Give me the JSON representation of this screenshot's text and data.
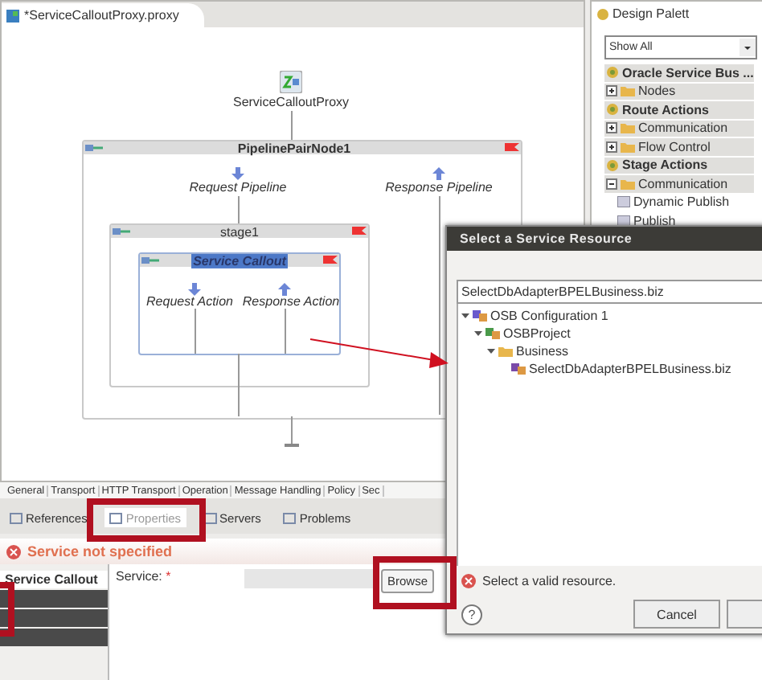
{
  "editor": {
    "tab": {
      "title": "*ServiceCalloutProxy.proxy",
      "dirty": true
    },
    "diagram": {
      "proxy": {
        "label": "ServiceCalloutProxy"
      },
      "pipeline_pair": {
        "title": "PipelinePairNode1",
        "request": "Request Pipeline",
        "response": "Response Pipeline"
      },
      "stage": {
        "title": "stage1"
      },
      "action": {
        "title": "Service Callout",
        "selected": true,
        "request": "Request Action",
        "response": "Response Action"
      }
    }
  },
  "palette": {
    "title": "Design Palett",
    "filter": "Show All",
    "items": [
      {
        "kind": "category",
        "label": "Oracle Service Bus ..."
      },
      {
        "kind": "folder",
        "label": "Nodes",
        "expanded": false
      },
      {
        "kind": "category",
        "label": "Route Actions"
      },
      {
        "kind": "folder",
        "label": "Communication",
        "expanded": false
      },
      {
        "kind": "folder",
        "label": "Flow Control",
        "expanded": false
      },
      {
        "kind": "category",
        "label": "Stage Actions"
      },
      {
        "kind": "folder",
        "label": "Communication",
        "expanded": true
      },
      {
        "kind": "item",
        "label": "Dynamic Publish"
      },
      {
        "kind": "item",
        "label": "Publish"
      }
    ]
  },
  "properties": {
    "section_tabs": [
      "General",
      "Transport",
      "HTTP Transport",
      "Operation",
      "Message Handling",
      "Policy",
      "Sec"
    ],
    "view_tabs": [
      {
        "label": "References",
        "selected": false
      },
      {
        "label": "Properties",
        "selected": true
      },
      {
        "label": "Servers",
        "selected": false
      },
      {
        "label": "Problems",
        "selected": false
      }
    ],
    "error": "Service not specified",
    "side_tabs": [
      {
        "label": "Service Callout",
        "selected": true
      },
      {
        "selected": false
      },
      {
        "selected": false
      },
      {
        "selected": false
      }
    ],
    "service": {
      "label": "Service:",
      "required": "*"
    },
    "browse": "Browse"
  },
  "dialog": {
    "title": "Select a Service Resource",
    "search": "SelectDbAdapterBPELBusiness.biz",
    "tree": [
      {
        "kind": "config",
        "label": "OSB Configuration 1",
        "expanded": true,
        "children": [
          {
            "kind": "project",
            "label": "OSBProject",
            "expanded": true,
            "children": [
              {
                "kind": "folder",
                "label": "Business",
                "expanded": true,
                "children": [
                  {
                    "kind": "business",
                    "label": "SelectDbAdapterBPELBusiness.biz"
                  }
                ]
              }
            ]
          }
        ]
      }
    ],
    "message": "Select a valid resource.",
    "help": "?",
    "buttons": [
      {
        "label": "Cancel"
      }
    ]
  }
}
